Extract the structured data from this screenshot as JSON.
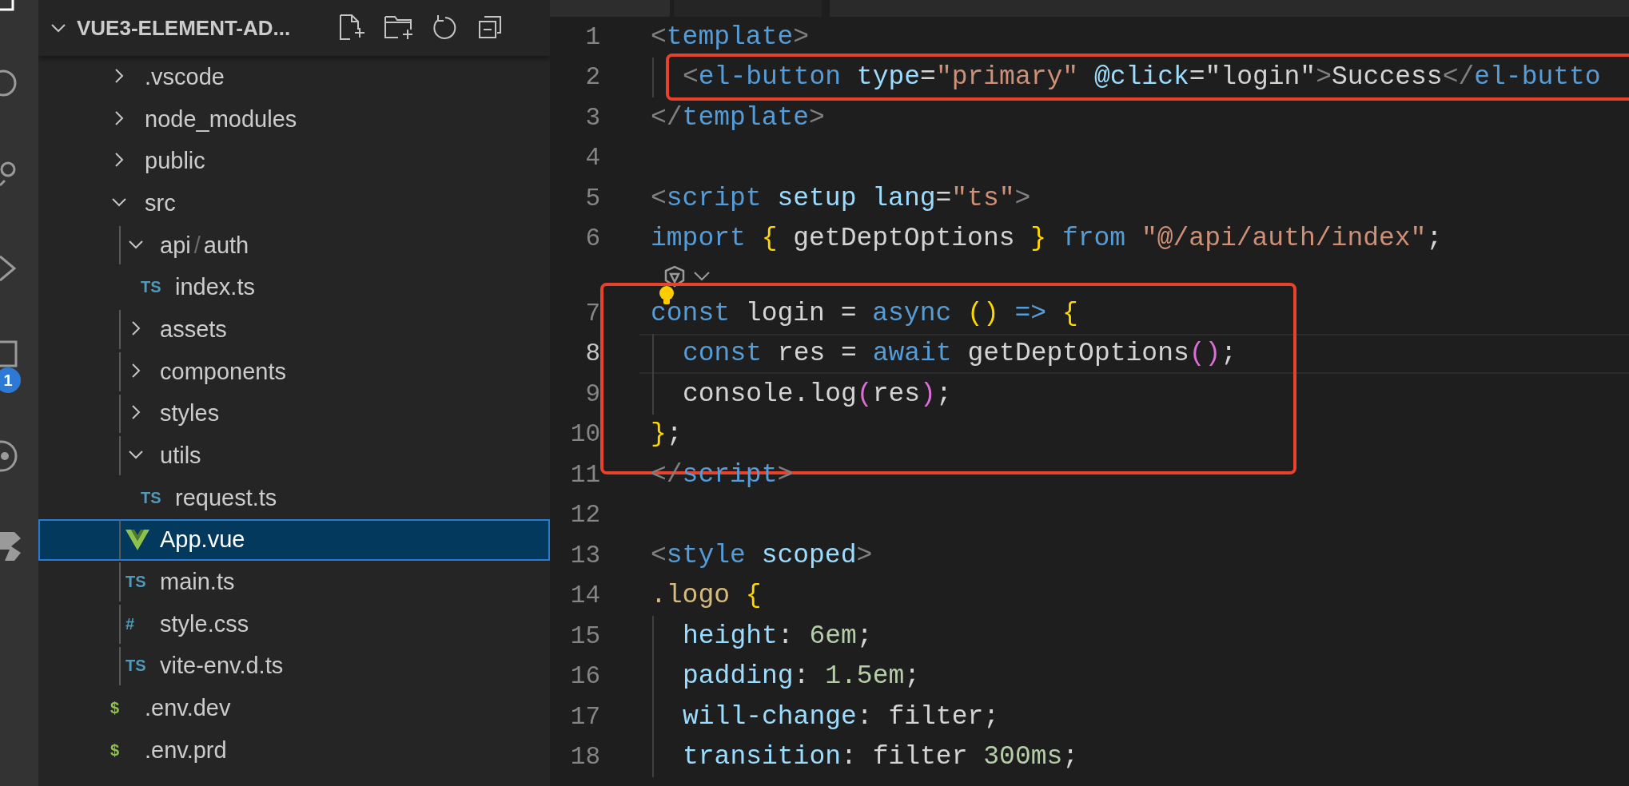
{
  "activity_bar": {
    "badge": "1"
  },
  "explorer": {
    "title": "VUE3-ELEMENT-AD...",
    "expanded": true,
    "items": [
      {
        "kind": "folder",
        "label": ".vscode",
        "expanded": false
      },
      {
        "kind": "folder",
        "label": "node_modules",
        "expanded": false
      },
      {
        "kind": "folder",
        "label": "public",
        "expanded": false
      },
      {
        "kind": "folder",
        "label": "src",
        "expanded": true,
        "children": [
          {
            "kind": "folder",
            "segments": [
              "api",
              "/",
              "auth"
            ],
            "expanded": true,
            "children": [
              {
                "kind": "ts",
                "icon_text": "TS",
                "label": "index.ts",
                "selected": false
              }
            ]
          },
          {
            "kind": "folder",
            "label": "assets",
            "expanded": false
          },
          {
            "kind": "folder",
            "label": "components",
            "expanded": false
          },
          {
            "kind": "folder",
            "label": "styles",
            "expanded": false
          },
          {
            "kind": "folder",
            "label": "utils",
            "expanded": true,
            "children": [
              {
                "kind": "ts",
                "icon_text": "TS",
                "label": "request.ts",
                "selected": false
              }
            ]
          },
          {
            "kind": "vue",
            "label": "App.vue",
            "selected": true
          },
          {
            "kind": "ts",
            "icon_text": "TS",
            "label": "main.ts",
            "selected": false
          },
          {
            "kind": "css",
            "icon_text": "#",
            "label": "style.css",
            "selected": false
          },
          {
            "kind": "ts",
            "icon_text": "TS",
            "label": "vite-env.d.ts",
            "selected": false
          }
        ]
      },
      {
        "kind": "env",
        "icon_text": "$",
        "label": ".env.dev",
        "selected": false
      },
      {
        "kind": "env",
        "icon_text": "$",
        "label": ".env.prd",
        "selected": false
      }
    ]
  },
  "editor": {
    "lines": [
      {
        "number": "1",
        "tokens": [
          {
            "kind": "p",
            "t": "<"
          },
          {
            "kind": "tag",
            "t": "template"
          },
          {
            "kind": "p",
            "t": ">"
          }
        ],
        "children": [
          {
            "number": "2",
            "boxed": true,
            "tokens": [
              {
                "kind": "p",
                "t": "<"
              },
              {
                "kind": "tag",
                "t": "el-button"
              },
              {
                "kind": "attr",
                "t": " type"
              },
              {
                "kind": "text",
                "t": "="
              },
              {
                "kind": "str",
                "t": "\"primary\""
              },
              {
                "kind": "attr",
                "t": " @click"
              },
              {
                "kind": "text",
                "t": "=\"login\""
              },
              {
                "kind": "p",
                "t": ">"
              },
              {
                "kind": "text",
                "t": "Success"
              },
              {
                "kind": "p",
                "t": "</"
              },
              {
                "kind": "tag",
                "t": "el-butto"
              }
            ]
          }
        ]
      },
      {
        "number": "3",
        "tokens": [
          {
            "kind": "p",
            "t": "</"
          },
          {
            "kind": "tag",
            "t": "template"
          },
          {
            "kind": "p",
            "t": ">"
          }
        ]
      },
      {
        "number": "4"
      },
      {
        "number": "5",
        "tokens": [
          {
            "kind": "p",
            "t": "<"
          },
          {
            "kind": "tag",
            "t": "script"
          },
          {
            "kind": "attr",
            "t": " setup"
          },
          {
            "kind": "attr",
            "t": " lang"
          },
          {
            "kind": "text",
            "t": "="
          },
          {
            "kind": "str",
            "t": "\"ts\""
          },
          {
            "kind": "p",
            "t": ">"
          }
        ]
      },
      {
        "number": "6",
        "tokens": [
          {
            "kind": "kw",
            "t": "import"
          },
          {
            "kind": "b1",
            "t": " {"
          },
          {
            "kind": "text",
            "t": " getDeptOptions "
          },
          {
            "kind": "b1",
            "t": "}"
          },
          {
            "kind": "kw",
            "t": " from"
          },
          {
            "kind": "str",
            "t": " \"@/api/auth/index\""
          },
          {
            "kind": "text",
            "t": ";"
          }
        ]
      },
      {
        "number": "7",
        "codelens_above": true,
        "lightbulb": true,
        "boxed": true,
        "tokens": [
          {
            "kind": "kw",
            "t": "const"
          },
          {
            "kind": "text",
            "t": " login = "
          },
          {
            "kind": "kw",
            "t": "async"
          },
          {
            "kind": "b1",
            "t": " ()"
          },
          {
            "kind": "kw",
            "t": " =>"
          },
          {
            "kind": "b1",
            "t": " {"
          }
        ],
        "children": [
          {
            "number": "8",
            "active": true,
            "boxed": true,
            "tokens": [
              {
                "kind": "kw",
                "t": "const"
              },
              {
                "kind": "text",
                "t": " res = "
              },
              {
                "kind": "kw",
                "t": "await"
              },
              {
                "kind": "text",
                "t": " getDeptOptions"
              },
              {
                "kind": "b2",
                "t": "()"
              },
              {
                "kind": "text",
                "t": ";"
              }
            ]
          },
          {
            "number": "9",
            "boxed": true,
            "tokens": [
              {
                "kind": "text",
                "t": "console.log"
              },
              {
                "kind": "b2",
                "t": "("
              },
              {
                "kind": "text",
                "t": "res"
              },
              {
                "kind": "b2",
                "t": ")"
              },
              {
                "kind": "text",
                "t": ";"
              }
            ]
          }
        ]
      },
      {
        "number": "10",
        "boxed": true,
        "tokens": [
          {
            "kind": "b1",
            "t": "}"
          },
          {
            "kind": "text",
            "t": ";"
          }
        ]
      },
      {
        "number": "11",
        "tokens": [
          {
            "kind": "p",
            "t": "</"
          },
          {
            "kind": "tag",
            "t": "script"
          },
          {
            "kind": "p",
            "t": ">"
          }
        ]
      },
      {
        "number": "12"
      },
      {
        "number": "13",
        "tokens": [
          {
            "kind": "p",
            "t": "<"
          },
          {
            "kind": "tag",
            "t": "style"
          },
          {
            "kind": "attr",
            "t": " scoped"
          },
          {
            "kind": "p",
            "t": ">"
          }
        ]
      },
      {
        "number": "14",
        "tokens": [
          {
            "kind": "sel",
            "t": ".logo"
          },
          {
            "kind": "b1",
            "t": " {"
          }
        ],
        "children": [
          {
            "number": "15",
            "tokens": [
              {
                "kind": "attr",
                "t": "height"
              },
              {
                "kind": "text",
                "t": ": "
              },
              {
                "kind": "num",
                "t": "6em"
              },
              {
                "kind": "text",
                "t": ";"
              }
            ]
          },
          {
            "number": "16",
            "tokens": [
              {
                "kind": "attr",
                "t": "padding"
              },
              {
                "kind": "text",
                "t": ": "
              },
              {
                "kind": "num",
                "t": "1.5em"
              },
              {
                "kind": "text",
                "t": ";"
              }
            ]
          },
          {
            "number": "17",
            "tokens": [
              {
                "kind": "attr",
                "t": "will-change"
              },
              {
                "kind": "text",
                "t": ": filter;"
              }
            ]
          },
          {
            "number": "18",
            "tokens": [
              {
                "kind": "attr",
                "t": "transition"
              },
              {
                "kind": "text",
                "t": ": filter "
              },
              {
                "kind": "num",
                "t": "300ms"
              },
              {
                "kind": "text",
                "t": ";"
              }
            ]
          }
        ]
      }
    ]
  }
}
